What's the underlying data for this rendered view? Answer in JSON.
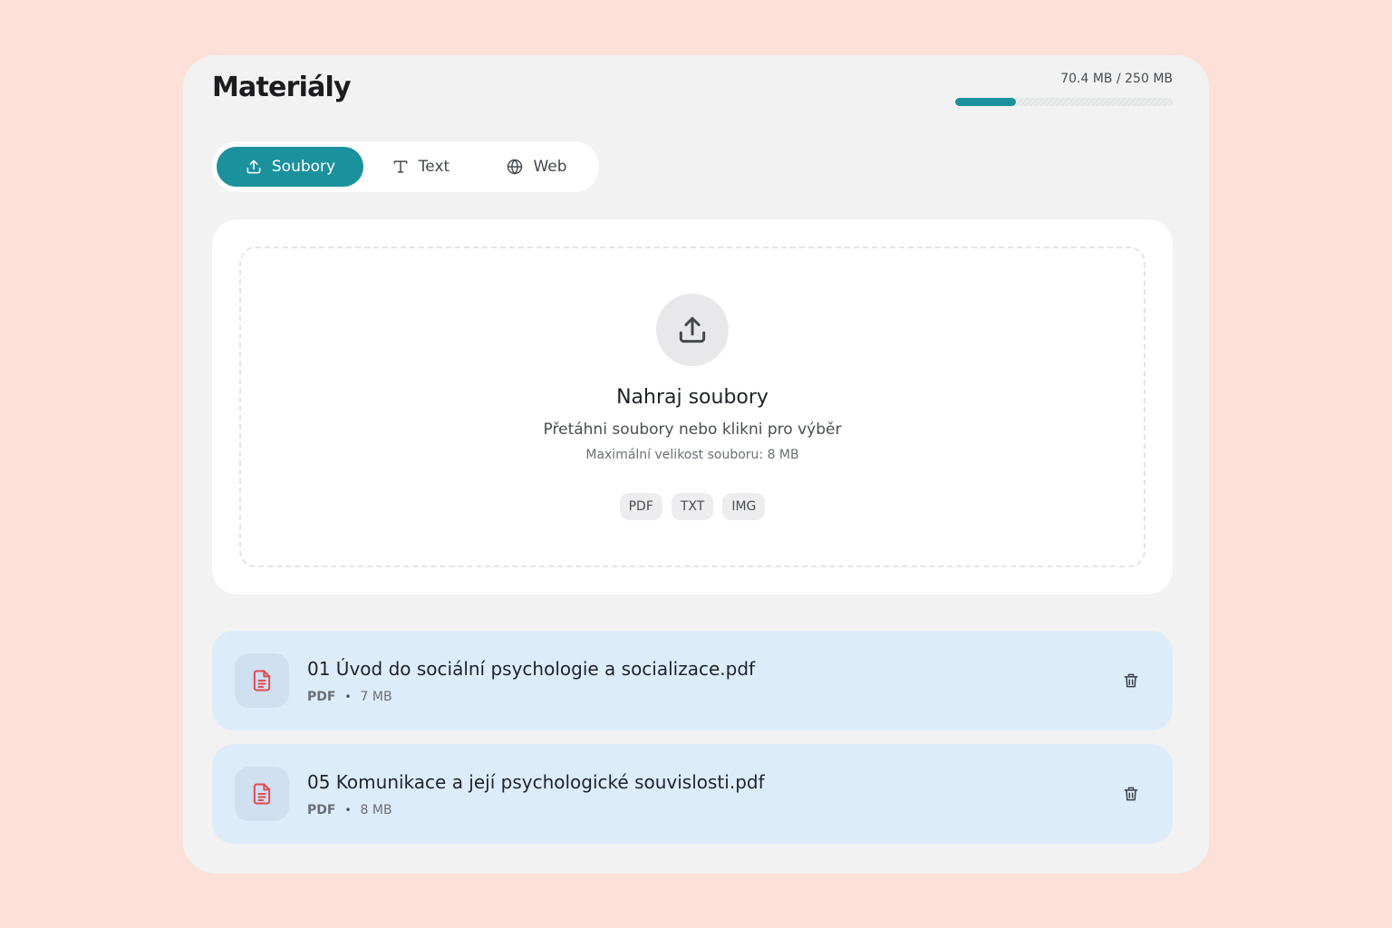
{
  "header": {
    "title": "Materiály",
    "storage": {
      "used": "70.4 MB",
      "separator": "/",
      "total": "250 MB",
      "label": "70.4 MB / 250 MB",
      "fill_fraction": 0.28,
      "accent": "#1a919c"
    }
  },
  "tabs": [
    {
      "label": "Soubory",
      "icon": "upload-icon",
      "active": true
    },
    {
      "label": "Text",
      "icon": "text-icon",
      "active": false
    },
    {
      "label": "Web",
      "icon": "globe-icon",
      "active": false
    }
  ],
  "upload": {
    "icon": "upload-icon",
    "title": "Nahraj soubory",
    "subtitle": "Přetáhni soubory nebo klikni pro výběr",
    "note": "Maximální velikost souboru: 8 MB",
    "formats": [
      "PDF",
      "TXT",
      "IMG"
    ]
  },
  "files": [
    {
      "name": "01 Úvod do sociální psychologie a socializace.pdf",
      "type": "PDF",
      "dot": "•",
      "size": "7 MB",
      "icon": "pdf-file-icon",
      "action_icon": "trash-icon"
    },
    {
      "name": "05 Komunikace a její psychologické souvislosti.pdf",
      "type": "PDF",
      "dot": "•",
      "size": "8 MB",
      "icon": "pdf-file-icon",
      "action_icon": "trash-icon"
    }
  ],
  "colors": {
    "background": "#fde0d8",
    "panel": "#f1f2f1",
    "accent": "#1a919c",
    "file_row": "#ddecfb",
    "pdf_icon": "#e5484d"
  }
}
